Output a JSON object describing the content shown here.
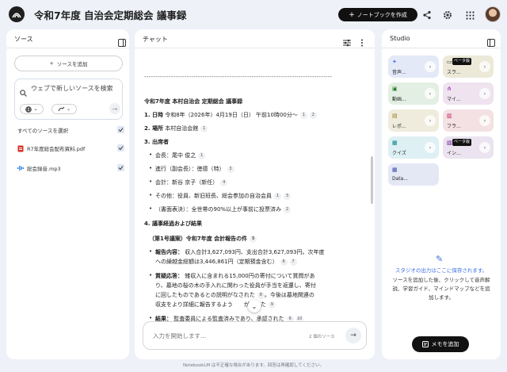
{
  "header": {
    "title": "令和7年度 自治会定期総会 議事録",
    "create_label": "ノートブックを作成"
  },
  "sources": {
    "title": "ソース",
    "add_label": "ソースを追加",
    "search_placeholder": "ウェブで新しいソースを検索",
    "select_all": "すべてのソースを選択",
    "items": [
      {
        "label": "R7年度総会配布資料.pdf",
        "icon": "pdf-icon",
        "color": "#d93025"
      },
      {
        "label": "総会録音.mp3",
        "icon": "audio-icon",
        "color": "#1a73e8"
      }
    ]
  },
  "chat": {
    "title": "チャット",
    "divider": "------------------------------------------------------------------------------------",
    "heading": "令和7年度 本村自治会 定期総会 議事録",
    "l1_label": "1. 日時",
    "l1_text": " 令和8年（2026年）4月19日（日） 午前10時00分〜",
    "l2_label": "2. 場所",
    "l2_text": " 本村自治会館",
    "l3": "3. 出席者",
    "att1": "会長：尾中 俊之",
    "att2": "進行（副会長）：徳德（特）",
    "att3": "会計：新谷 京子（新任）",
    "att4": "その他：役員、新旧班長、総会参加の自治会員",
    "att5": "（書面表決）：全世帯の90%以上が事前に投票済み",
    "l4": "4. 議事経過および結果",
    "item1": "（第1号議案）令和7年度 会計報告の件",
    "rep_label": "報告内容：",
    "rep_l1": " 収入合計3,627,093円、支出合計3,627,093円。次年度",
    "rep_l2": "への繰越金総額は3,446,861円（定期預金含む）",
    "qa_label": "質疑応答：",
    "qa_l1": " 雑収入に含まれる15,000円の寄付について質問があ",
    "qa_l2": "り、墓地の桜の木の手入れに関わった役員が手当を返還し、寄付",
    "qa_l3": "に回したものであるとの説明がなされた",
    "qa_l3b": "。今後は墓地関連の",
    "qa_l4": "収支をより詳細に報告するよう",
    "qa_l4b": "があった",
    "res_label": "結果：",
    "res_text": " 監査委員による監査済みであり、承認された",
    "cites": [
      "1",
      "2",
      "1",
      "1",
      "3",
      "4",
      "1",
      "3",
      "2",
      "5",
      "6",
      "7",
      "8",
      "9",
      "6",
      "10"
    ],
    "input_placeholder": "入力を開始します...",
    "source_count": "2 個のソース"
  },
  "studio": {
    "title": "Studio",
    "tiles": [
      {
        "label": "音声...",
        "icon": "audio-overview-icon",
        "bg": "#e3e9f7"
      },
      {
        "label": "スラ...",
        "icon": "slides-icon",
        "bg": "#ece9d8",
        "badge": "ベータ版"
      },
      {
        "label": "動画...",
        "icon": "video-icon",
        "bg": "#e3efe3"
      },
      {
        "label": "マイ...",
        "icon": "mindmap-icon",
        "bg": "#efe3ef"
      },
      {
        "label": "レポ...",
        "icon": "report-icon",
        "bg": "#efecdd"
      },
      {
        "label": "フラ...",
        "icon": "flashcard-icon",
        "bg": "#f3e1e3"
      },
      {
        "label": "クイズ",
        "icon": "quiz-icon",
        "bg": "#def0f3"
      },
      {
        "label": "イン...",
        "icon": "infographic-icon",
        "bg": "#ebe3ef",
        "badge": "ベータ版"
      },
      {
        "label": "Data...",
        "icon": "datatable-icon",
        "bg": "#e4e8f5"
      }
    ],
    "empty_title": "スタジオの出力はここに保存されます。",
    "empty_desc": "ソースを追加した後、クリックして音声解説、学習ガイド、マインドマップなどを追加します。",
    "memo_label": "メモを追加"
  },
  "footer": "NotebookLM は不正確な場合があります。回答は再確認してください。",
  "colors": {
    "accent": "#3b6fe0",
    "background": "#eef1f8"
  }
}
